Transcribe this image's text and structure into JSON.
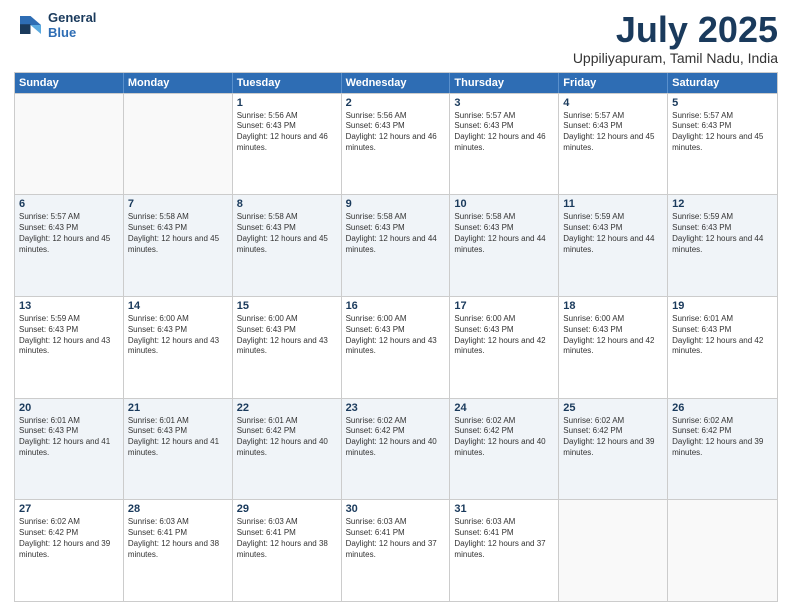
{
  "header": {
    "logo_line1": "General",
    "logo_line2": "Blue",
    "main_title": "July 2025",
    "subtitle": "Uppiliyapuram, Tamil Nadu, India"
  },
  "weekdays": [
    "Sunday",
    "Monday",
    "Tuesday",
    "Wednesday",
    "Thursday",
    "Friday",
    "Saturday"
  ],
  "rows": [
    [
      {
        "day": "",
        "sunrise": "",
        "sunset": "",
        "daylight": "",
        "empty": true
      },
      {
        "day": "",
        "sunrise": "",
        "sunset": "",
        "daylight": "",
        "empty": true
      },
      {
        "day": "1",
        "sunrise": "Sunrise: 5:56 AM",
        "sunset": "Sunset: 6:43 PM",
        "daylight": "Daylight: 12 hours and 46 minutes."
      },
      {
        "day": "2",
        "sunrise": "Sunrise: 5:56 AM",
        "sunset": "Sunset: 6:43 PM",
        "daylight": "Daylight: 12 hours and 46 minutes."
      },
      {
        "day": "3",
        "sunrise": "Sunrise: 5:57 AM",
        "sunset": "Sunset: 6:43 PM",
        "daylight": "Daylight: 12 hours and 46 minutes."
      },
      {
        "day": "4",
        "sunrise": "Sunrise: 5:57 AM",
        "sunset": "Sunset: 6:43 PM",
        "daylight": "Daylight: 12 hours and 45 minutes."
      },
      {
        "day": "5",
        "sunrise": "Sunrise: 5:57 AM",
        "sunset": "Sunset: 6:43 PM",
        "daylight": "Daylight: 12 hours and 45 minutes."
      }
    ],
    [
      {
        "day": "6",
        "sunrise": "Sunrise: 5:57 AM",
        "sunset": "Sunset: 6:43 PM",
        "daylight": "Daylight: 12 hours and 45 minutes."
      },
      {
        "day": "7",
        "sunrise": "Sunrise: 5:58 AM",
        "sunset": "Sunset: 6:43 PM",
        "daylight": "Daylight: 12 hours and 45 minutes."
      },
      {
        "day": "8",
        "sunrise": "Sunrise: 5:58 AM",
        "sunset": "Sunset: 6:43 PM",
        "daylight": "Daylight: 12 hours and 45 minutes."
      },
      {
        "day": "9",
        "sunrise": "Sunrise: 5:58 AM",
        "sunset": "Sunset: 6:43 PM",
        "daylight": "Daylight: 12 hours and 44 minutes."
      },
      {
        "day": "10",
        "sunrise": "Sunrise: 5:58 AM",
        "sunset": "Sunset: 6:43 PM",
        "daylight": "Daylight: 12 hours and 44 minutes."
      },
      {
        "day": "11",
        "sunrise": "Sunrise: 5:59 AM",
        "sunset": "Sunset: 6:43 PM",
        "daylight": "Daylight: 12 hours and 44 minutes."
      },
      {
        "day": "12",
        "sunrise": "Sunrise: 5:59 AM",
        "sunset": "Sunset: 6:43 PM",
        "daylight": "Daylight: 12 hours and 44 minutes."
      }
    ],
    [
      {
        "day": "13",
        "sunrise": "Sunrise: 5:59 AM",
        "sunset": "Sunset: 6:43 PM",
        "daylight": "Daylight: 12 hours and 43 minutes."
      },
      {
        "day": "14",
        "sunrise": "Sunrise: 6:00 AM",
        "sunset": "Sunset: 6:43 PM",
        "daylight": "Daylight: 12 hours and 43 minutes."
      },
      {
        "day": "15",
        "sunrise": "Sunrise: 6:00 AM",
        "sunset": "Sunset: 6:43 PM",
        "daylight": "Daylight: 12 hours and 43 minutes."
      },
      {
        "day": "16",
        "sunrise": "Sunrise: 6:00 AM",
        "sunset": "Sunset: 6:43 PM",
        "daylight": "Daylight: 12 hours and 43 minutes."
      },
      {
        "day": "17",
        "sunrise": "Sunrise: 6:00 AM",
        "sunset": "Sunset: 6:43 PM",
        "daylight": "Daylight: 12 hours and 42 minutes."
      },
      {
        "day": "18",
        "sunrise": "Sunrise: 6:00 AM",
        "sunset": "Sunset: 6:43 PM",
        "daylight": "Daylight: 12 hours and 42 minutes."
      },
      {
        "day": "19",
        "sunrise": "Sunrise: 6:01 AM",
        "sunset": "Sunset: 6:43 PM",
        "daylight": "Daylight: 12 hours and 42 minutes."
      }
    ],
    [
      {
        "day": "20",
        "sunrise": "Sunrise: 6:01 AM",
        "sunset": "Sunset: 6:43 PM",
        "daylight": "Daylight: 12 hours and 41 minutes."
      },
      {
        "day": "21",
        "sunrise": "Sunrise: 6:01 AM",
        "sunset": "Sunset: 6:43 PM",
        "daylight": "Daylight: 12 hours and 41 minutes."
      },
      {
        "day": "22",
        "sunrise": "Sunrise: 6:01 AM",
        "sunset": "Sunset: 6:42 PM",
        "daylight": "Daylight: 12 hours and 40 minutes."
      },
      {
        "day": "23",
        "sunrise": "Sunrise: 6:02 AM",
        "sunset": "Sunset: 6:42 PM",
        "daylight": "Daylight: 12 hours and 40 minutes."
      },
      {
        "day": "24",
        "sunrise": "Sunrise: 6:02 AM",
        "sunset": "Sunset: 6:42 PM",
        "daylight": "Daylight: 12 hours and 40 minutes."
      },
      {
        "day": "25",
        "sunrise": "Sunrise: 6:02 AM",
        "sunset": "Sunset: 6:42 PM",
        "daylight": "Daylight: 12 hours and 39 minutes."
      },
      {
        "day": "26",
        "sunrise": "Sunrise: 6:02 AM",
        "sunset": "Sunset: 6:42 PM",
        "daylight": "Daylight: 12 hours and 39 minutes."
      }
    ],
    [
      {
        "day": "27",
        "sunrise": "Sunrise: 6:02 AM",
        "sunset": "Sunset: 6:42 PM",
        "daylight": "Daylight: 12 hours and 39 minutes."
      },
      {
        "day": "28",
        "sunrise": "Sunrise: 6:03 AM",
        "sunset": "Sunset: 6:41 PM",
        "daylight": "Daylight: 12 hours and 38 minutes."
      },
      {
        "day": "29",
        "sunrise": "Sunrise: 6:03 AM",
        "sunset": "Sunset: 6:41 PM",
        "daylight": "Daylight: 12 hours and 38 minutes."
      },
      {
        "day": "30",
        "sunrise": "Sunrise: 6:03 AM",
        "sunset": "Sunset: 6:41 PM",
        "daylight": "Daylight: 12 hours and 37 minutes."
      },
      {
        "day": "31",
        "sunrise": "Sunrise: 6:03 AM",
        "sunset": "Sunset: 6:41 PM",
        "daylight": "Daylight: 12 hours and 37 minutes."
      },
      {
        "day": "",
        "sunrise": "",
        "sunset": "",
        "daylight": "",
        "empty": true
      },
      {
        "day": "",
        "sunrise": "",
        "sunset": "",
        "daylight": "",
        "empty": true
      }
    ]
  ]
}
